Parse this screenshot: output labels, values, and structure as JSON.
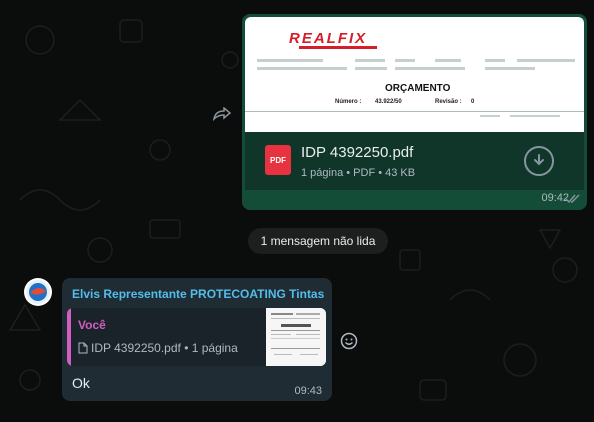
{
  "outgoing": {
    "preview": {
      "logo_text": "REALFIX",
      "doc_title": "ORÇAMENTO",
      "number_label": "Número :",
      "number_value": "43.922/50",
      "revision_label": "Revisão :",
      "revision_value": "0"
    },
    "file_name": "IDP 4392250.pdf",
    "file_meta": "1 página • PDF • 43 KB",
    "file_type_badge": "PDF",
    "time": "09:42"
  },
  "unread_banner": "1 mensagem não lida",
  "incoming": {
    "sender": "Elvis Representante PROTECOATING Tintas",
    "quote_author": "Você",
    "quote_text": "IDP 4392250.pdf • 1 página",
    "text": "Ok",
    "time": "09:43"
  },
  "icons": {
    "forward": "forward-icon",
    "pdf": "pdf-file-icon",
    "download": "download-icon",
    "read_receipt": "double-check-icon",
    "document": "document-icon",
    "emoji": "emoji-icon",
    "avatar": "avatar"
  },
  "colors": {
    "background": "#0b0c0c",
    "outgoing_bubble": "#144d37",
    "incoming_bubble": "#202c33",
    "sender_name": "#53bdeb",
    "quote_accent": "#d35ec1",
    "pdf_red": "#e8323f"
  }
}
